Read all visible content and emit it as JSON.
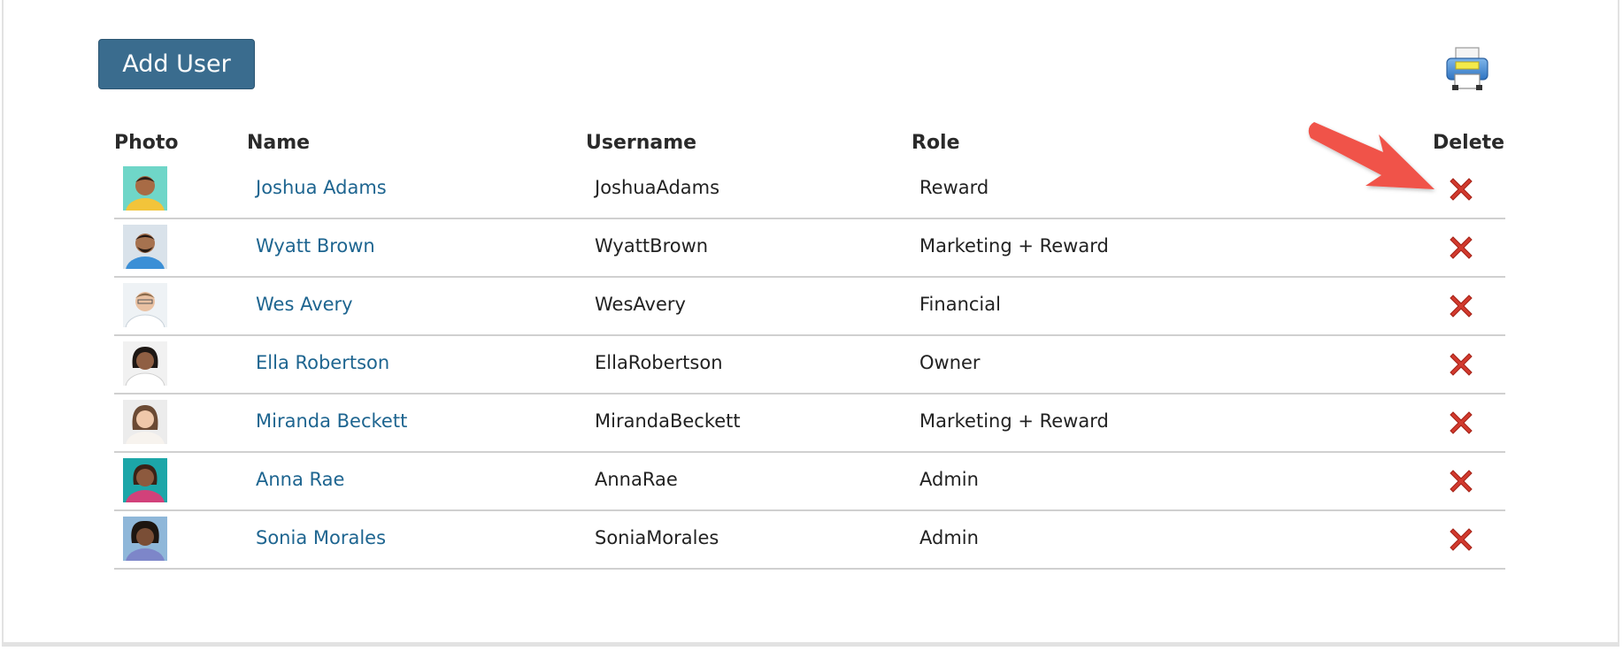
{
  "toolbar": {
    "add_user_label": "Add User",
    "print_icon": "printer-icon"
  },
  "table": {
    "headers": {
      "photo": "Photo",
      "name": "Name",
      "username": "Username",
      "role": "Role",
      "delete": "Delete"
    },
    "rows": [
      {
        "name": "Joshua Adams",
        "username": "JoshuaAdams",
        "role": "Reward"
      },
      {
        "name": "Wyatt Brown",
        "username": "WyattBrown",
        "role": "Marketing + Reward"
      },
      {
        "name": "Wes Avery",
        "username": "WesAvery",
        "role": "Financial"
      },
      {
        "name": "Ella Robertson",
        "username": "EllaRobertson",
        "role": "Owner"
      },
      {
        "name": "Miranda Beckett",
        "username": "MirandaBeckett",
        "role": "Marketing + Reward"
      },
      {
        "name": "Anna Rae",
        "username": "AnnaRae",
        "role": "Admin"
      },
      {
        "name": "Sonia Morales",
        "username": "SoniaMorales",
        "role": "Admin"
      }
    ],
    "delete_icon": "red-x-delete-icon"
  },
  "colors": {
    "button_bg": "#3a6c8e",
    "link": "#1e6590",
    "delete_red": "#d23a2e",
    "annotation_arrow": "#f0534a"
  }
}
